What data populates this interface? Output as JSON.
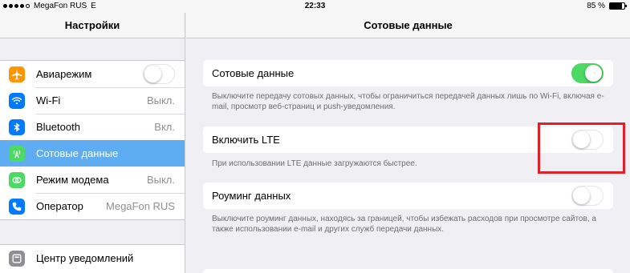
{
  "status_bar": {
    "carrier": "MegaFon RUS",
    "network": "E",
    "time": "22:33",
    "battery_text": "85 %",
    "battery_level": 0.85,
    "signal_bars_filled": 4,
    "signal_bars_total": 5
  },
  "sidebar": {
    "title": "Настройки",
    "group1": [
      {
        "label": "Авиарежим",
        "icon": "airplane-icon",
        "color": "#ff9500",
        "toggle": false
      },
      {
        "label": "Wi-Fi",
        "icon": "wifi-icon",
        "color": "#007aff",
        "value": "Выкл."
      },
      {
        "label": "Bluetooth",
        "icon": "bluetooth-icon",
        "color": "#007aff",
        "value": "Вкл."
      },
      {
        "label": "Сотовые данные",
        "icon": "cellular-icon",
        "color": "#4cd964",
        "selected": true
      },
      {
        "label": "Режим модема",
        "icon": "hotspot-icon",
        "color": "#4cd964",
        "value": "Выкл."
      },
      {
        "label": "Оператор",
        "icon": "phone-icon",
        "color": "#007aff",
        "value": "MegaFon RUS"
      }
    ],
    "group2": [
      {
        "label": "Центр уведомлений",
        "icon": "notifications-icon",
        "color": "#8e8e93"
      }
    ]
  },
  "main": {
    "title": "Сотовые данные",
    "cellular": {
      "label": "Сотовые данные",
      "on": true,
      "footer": "Выключите передачу сотовых данных, чтобы ограничиться передачей данных лишь по Wi-Fi, включая e-mail, просмотр веб-страниц и push-уведомления."
    },
    "lte": {
      "label": "Включить LTE",
      "on": false,
      "footer": "При использовании LTE данные загружаются быстрее."
    },
    "roaming": {
      "label": "Роуминг данных",
      "on": false,
      "footer": "Выключите роуминг данных, находясь за границей, чтобы избежать расходов при просмотре сайтов, а также использовании e-mail и других служб передачи данных."
    }
  },
  "colors": {
    "accent_selected": "#5eadf3",
    "switch_on": "#4cd964",
    "highlight": "#e0202b"
  }
}
